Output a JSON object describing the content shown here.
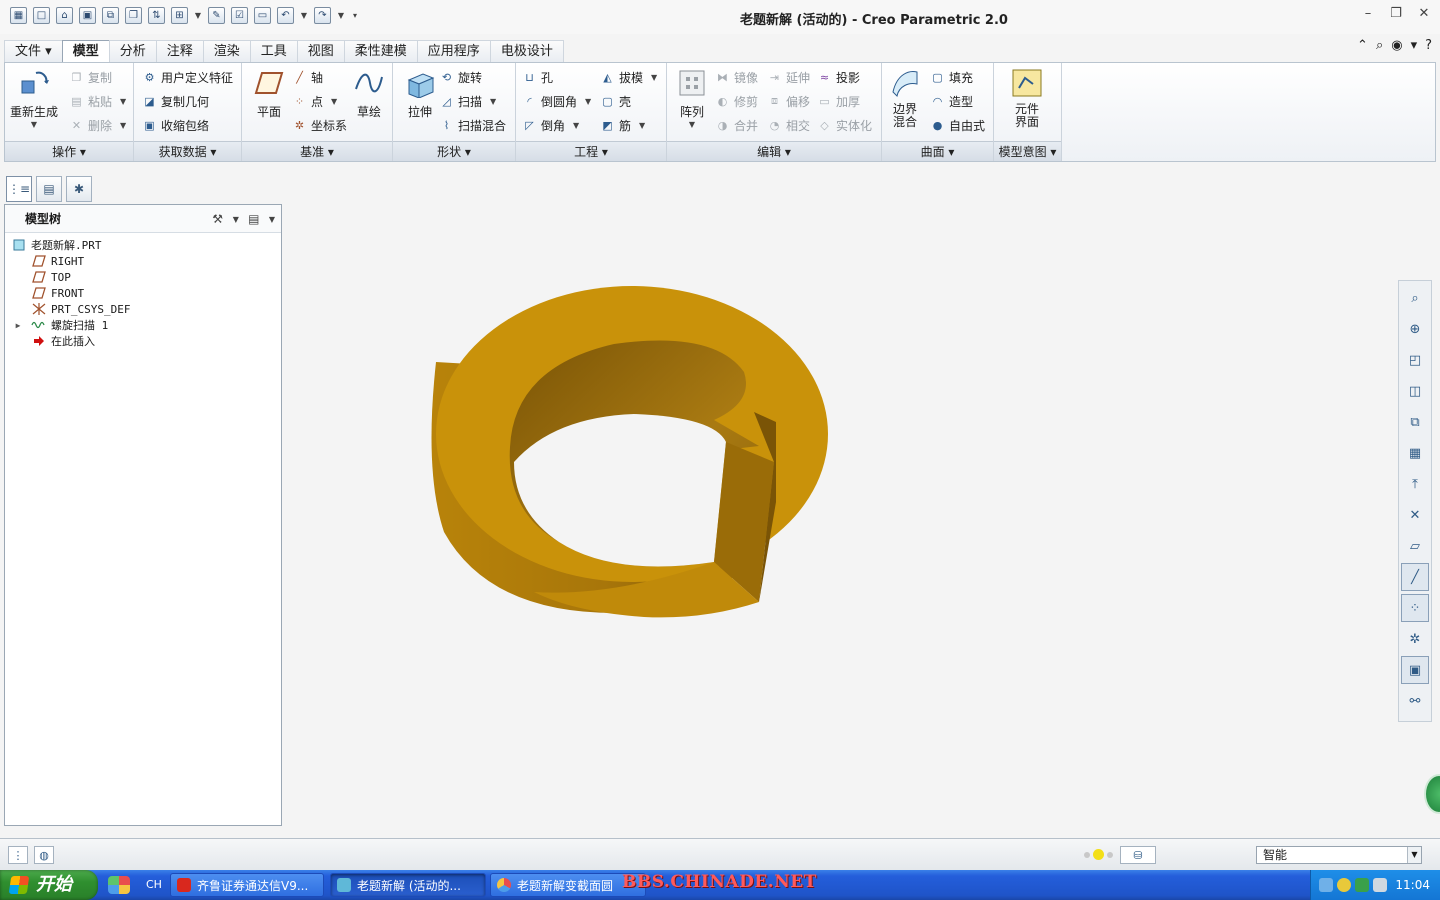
{
  "window": {
    "title": "老题新解 (活动的) - Creo Parametric 2.0"
  },
  "menu_tabs": [
    "文件",
    "模型",
    "分析",
    "注释",
    "渲染",
    "工具",
    "视图",
    "柔性建模",
    "应用程序",
    "电极设计"
  ],
  "active_tab": "模型",
  "ribbon": {
    "operations": {
      "title": "操作",
      "regenerate": "重新生成",
      "copy": "复制",
      "paste": "粘贴",
      "delete": "删除"
    },
    "get_data": {
      "title": "获取数据",
      "udf": "用户定义特征",
      "copy_geom": "复制几何",
      "shrinkwrap": "收缩包络"
    },
    "datum": {
      "title": "基准",
      "plane": "平面",
      "axis": "轴",
      "point": "点",
      "csys": "坐标系",
      "sketch": "草绘"
    },
    "shapes": {
      "title": "形状",
      "extrude": "拉伸",
      "revolve": "旋转",
      "sweep": "扫描",
      "swept_blend": "扫描混合"
    },
    "engineering": {
      "title": "工程",
      "hole": "孔",
      "round": "倒圆角",
      "chamfer": "倒角",
      "draft": "拔模",
      "shell": "壳",
      "rib": "筋"
    },
    "editing": {
      "title": "编辑",
      "pattern": "阵列",
      "mirror": "镜像",
      "trim": "修剪",
      "merge": "合并",
      "extend": "延伸",
      "offset": "偏移",
      "intersect": "相交",
      "project": "投影",
      "thicken": "加厚",
      "solidify": "实体化"
    },
    "surfaces": {
      "title": "曲面",
      "boundary_blend_1": "边界",
      "boundary_blend_2": "混合",
      "fill": "填充",
      "style": "造型",
      "freestyle": "自由式"
    },
    "model_intent": {
      "title": "模型意图",
      "component_interface_1": "元件",
      "component_interface_2": "界面"
    }
  },
  "model_tree": {
    "title": "模型树",
    "items": [
      {
        "label": "老题新解.PRT",
        "icon": "part-icon"
      },
      {
        "label": "RIGHT",
        "icon": "datum-plane-icon"
      },
      {
        "label": "TOP",
        "icon": "datum-plane-icon"
      },
      {
        "label": "FRONT",
        "icon": "datum-plane-icon"
      },
      {
        "label": "PRT_CSYS_DEF",
        "icon": "csys-icon"
      },
      {
        "label": "螺旋扫描 1",
        "icon": "helical-sweep-icon"
      },
      {
        "label": "在此插入",
        "icon": "insert-here-arrow-icon"
      }
    ]
  },
  "status_bar": {
    "filter_value": "智能"
  },
  "taskbar": {
    "start_label": "开始",
    "lang": "CH",
    "items": [
      "齐鲁证券通达信V9...",
      "老题新解 (活动的...",
      "老题新解变截面圆"
    ],
    "watermark": "BBS.CHINADE.NET",
    "clock": "11:04"
  },
  "colors": {
    "model": "#c9920a",
    "taskbar": "#245edb",
    "start": "#2f8f2f"
  }
}
